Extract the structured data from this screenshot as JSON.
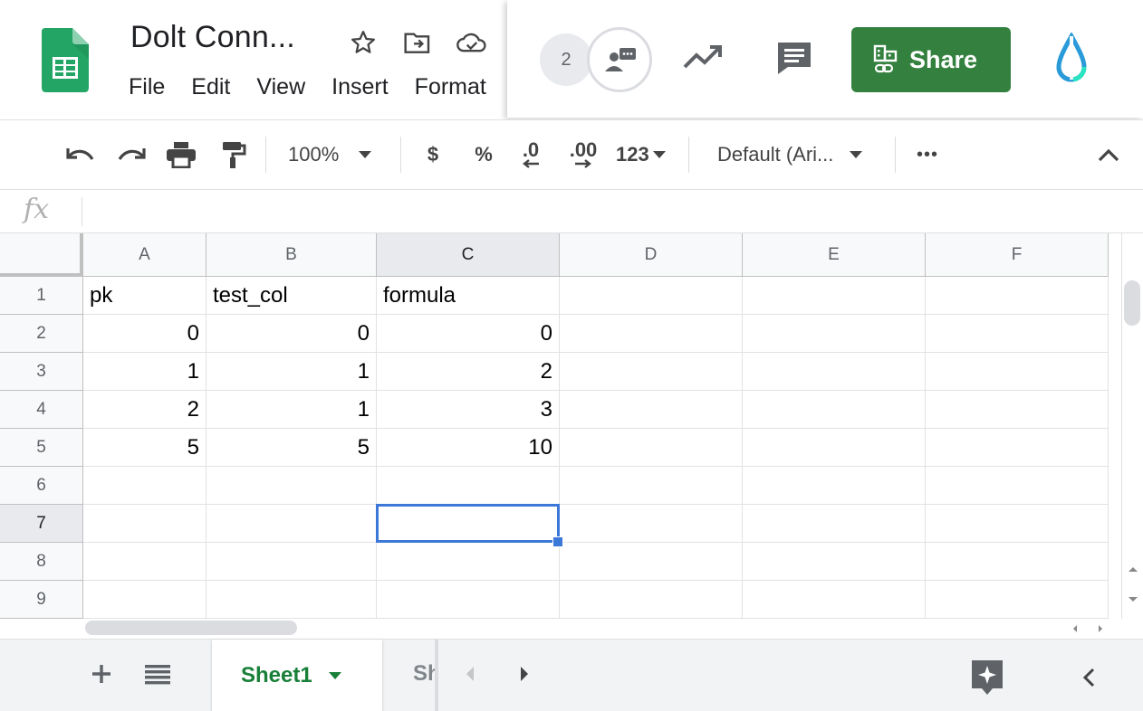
{
  "header": {
    "doc_title": "Dolt Conn...",
    "menu": [
      "File",
      "Edit",
      "View",
      "Insert",
      "Format"
    ],
    "collaborator_count": "2",
    "share_label": "Share"
  },
  "toolbar": {
    "zoom": "100%",
    "currency": "$",
    "percent": "%",
    "decrease_decimal": ".0",
    "increase_decimal": ".00",
    "number_format": "123",
    "font": "Default (Ari...",
    "more": "•••"
  },
  "formula_bar": {
    "fx": "fx",
    "value": ""
  },
  "grid": {
    "columns": [
      "A",
      "B",
      "C",
      "D",
      "E",
      "F"
    ],
    "rows": [
      "1",
      "2",
      "3",
      "4",
      "5",
      "6",
      "7",
      "8",
      "9"
    ],
    "cells": [
      [
        "pk",
        "test_col",
        "formula",
        "",
        "",
        ""
      ],
      [
        "0",
        "0",
        "0",
        "",
        "",
        ""
      ],
      [
        "1",
        "1",
        "2",
        "",
        "",
        ""
      ],
      [
        "2",
        "1",
        "3",
        "",
        "",
        ""
      ],
      [
        "5",
        "5",
        "10",
        "",
        "",
        ""
      ],
      [
        "",
        "",
        "",
        "",
        "",
        ""
      ],
      [
        "",
        "",
        "",
        "",
        "",
        ""
      ],
      [
        "",
        "",
        "",
        "",
        "",
        ""
      ],
      [
        "",
        "",
        "",
        "",
        "",
        ""
      ]
    ],
    "selected_cell": "C7"
  },
  "sheets": {
    "active": "Sheet1",
    "next_partial": "Sh"
  },
  "colors": {
    "share_green": "#34813f",
    "sheet_tab_green": "#188038",
    "selection_blue": "#3c78d8"
  }
}
